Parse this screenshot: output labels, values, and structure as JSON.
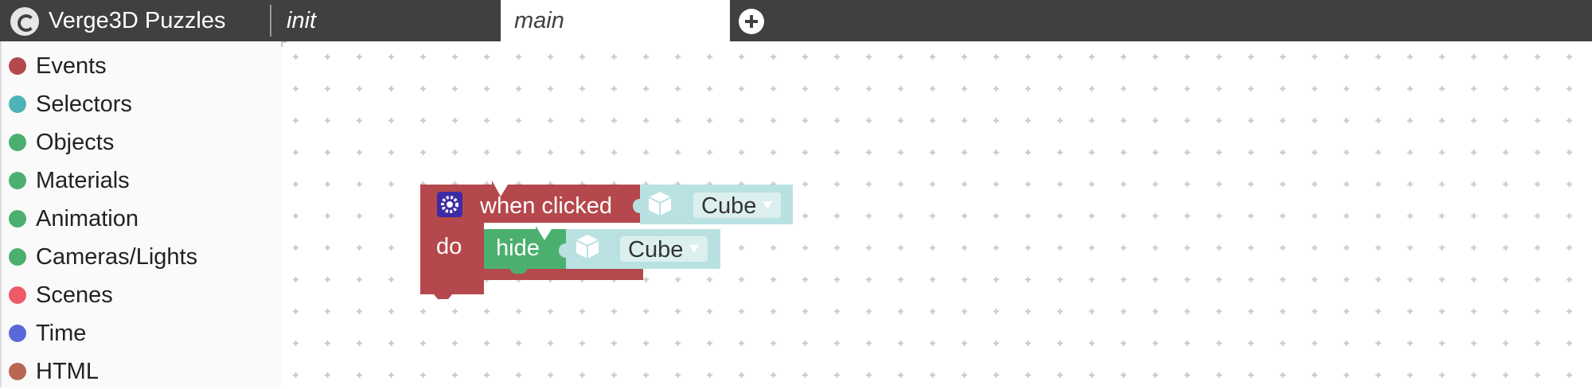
{
  "app": {
    "title": "Verge3D Puzzles",
    "logo_icon": "verge3d-logo-icon"
  },
  "tabs": [
    {
      "label": "init",
      "active": false
    },
    {
      "label": "main",
      "active": true
    }
  ],
  "add_tab_icon": "plus-circle-icon",
  "sidebar": {
    "categories": [
      {
        "label": "Events",
        "color": "#b5484c"
      },
      {
        "label": "Selectors",
        "color": "#4db3b7"
      },
      {
        "label": "Objects",
        "color": "#4bb06f"
      },
      {
        "label": "Materials",
        "color": "#4bb06f"
      },
      {
        "label": "Animation",
        "color": "#4bb06f"
      },
      {
        "label": "Cameras/Lights",
        "color": "#4bb06f"
      },
      {
        "label": "Scenes",
        "color": "#ef5a67"
      },
      {
        "label": "Time",
        "color": "#5b68d9"
      },
      {
        "label": "HTML",
        "color": "#b86552"
      }
    ]
  },
  "blocks": {
    "event": {
      "label": "when clicked",
      "do_label": "do",
      "settings_icon": "gear-icon",
      "color": "#b5484c",
      "object": {
        "icon": "cube-icon",
        "value": "Cube",
        "color": "#b9e1e2"
      }
    },
    "action": {
      "label": "hide",
      "color": "#4bb06f",
      "object": {
        "icon": "cube-icon",
        "value": "Cube",
        "color": "#b9e1e2"
      }
    }
  }
}
